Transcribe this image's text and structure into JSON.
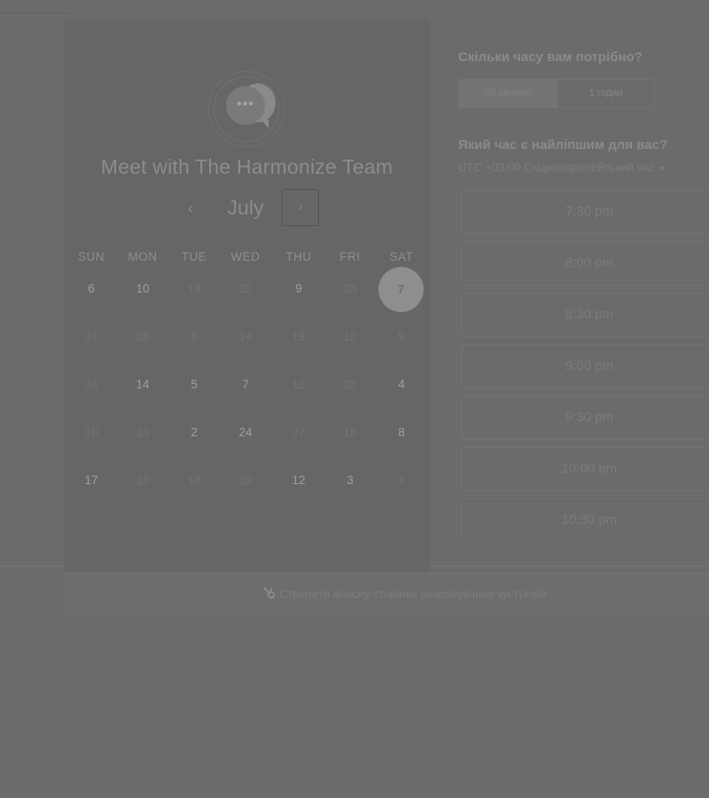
{
  "calendar": {
    "title": "Meet with The Harmonize Team",
    "month": "July",
    "prev_symbol": "‹",
    "next_symbol": "›",
    "weekdays": [
      "SUN",
      "MON",
      "TUE",
      "WED",
      "THU",
      "FRI",
      "SAT"
    ],
    "weeks": [
      [
        {
          "d": "6",
          "a": true
        },
        {
          "d": "10",
          "a": true
        },
        {
          "d": "18",
          "a": false
        },
        {
          "d": "22",
          "a": false
        },
        {
          "d": "9",
          "a": true
        },
        {
          "d": "25",
          "a": false
        },
        {
          "d": "7",
          "a": true,
          "selected": true
        }
      ],
      [
        {
          "d": "31",
          "a": false
        },
        {
          "d": "26",
          "a": false
        },
        {
          "d": "8",
          "a": false
        },
        {
          "d": "14",
          "a": false
        },
        {
          "d": "19",
          "a": false
        },
        {
          "d": "12",
          "a": false
        },
        {
          "d": "9",
          "a": false
        }
      ],
      [
        {
          "d": "24",
          "a": false
        },
        {
          "d": "14",
          "a": true
        },
        {
          "d": "5",
          "a": true
        },
        {
          "d": "7",
          "a": true
        },
        {
          "d": "12",
          "a": false
        },
        {
          "d": "25",
          "a": false
        },
        {
          "d": "4",
          "a": true
        }
      ],
      [
        {
          "d": "10",
          "a": false
        },
        {
          "d": "13",
          "a": false
        },
        {
          "d": "2",
          "a": true
        },
        {
          "d": "24",
          "a": true
        },
        {
          "d": "27",
          "a": false
        },
        {
          "d": "18",
          "a": false
        },
        {
          "d": "8",
          "a": true
        }
      ],
      [
        {
          "d": "17",
          "a": true
        },
        {
          "d": "13",
          "a": false
        },
        {
          "d": "18",
          "a": false
        },
        {
          "d": "29",
          "a": false
        },
        {
          "d": "12",
          "a": true
        },
        {
          "d": "3",
          "a": true
        },
        {
          "d": "4",
          "a": false
        }
      ]
    ]
  },
  "booking": {
    "duration_question": "Скільки часу вам потрібно?",
    "durations": [
      "30 хвилин",
      "1 годин"
    ],
    "time_question": "Який час є найліпшим для вас?",
    "timezone": "UTC +03:00 Східноєвропейський час",
    "slots": [
      "7:30 pm",
      "8:00 pm",
      "8:30 pm",
      "9:00 pm",
      "9:30 pm",
      "10:00 pm",
      "10:30 pm"
    ]
  },
  "footer": {
    "link": "Створити власну сторінка резервування зустрічей"
  }
}
